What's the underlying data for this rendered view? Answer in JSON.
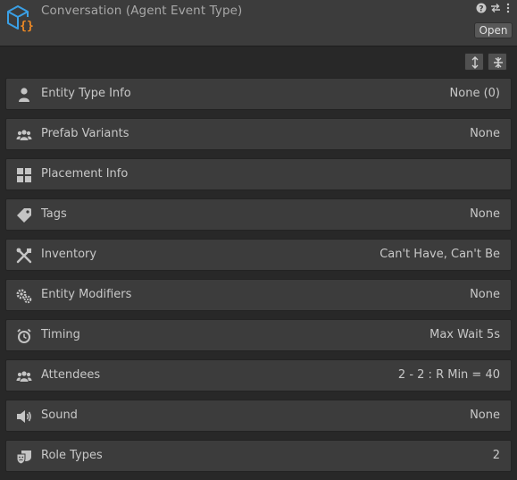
{
  "header": {
    "title": "Conversation (Agent Event Type)",
    "open_label": "Open",
    "help_glyph": "?",
    "settings_glyph": "⇄",
    "more_glyph": "⋮"
  },
  "toolbar": {
    "expand_all_icon": "expand-all-icon",
    "collapse_all_icon": "collapse-all-icon"
  },
  "rows": [
    {
      "label": "Entity Type Info",
      "value": "None (0)",
      "icon": "person-icon"
    },
    {
      "label": "Prefab Variants",
      "value": "None",
      "icon": "group-icon"
    },
    {
      "label": "Placement Info",
      "value": "",
      "icon": "grid-icon"
    },
    {
      "label": "Tags",
      "value": "None",
      "icon": "tag-icon"
    },
    {
      "label": "Inventory",
      "value": "Can't Have, Can't Be",
      "icon": "tools-icon"
    },
    {
      "label": "Entity Modifiers",
      "value": "None",
      "icon": "gears-icon"
    },
    {
      "label": "Timing",
      "value": "Max Wait 5s",
      "icon": "clock-icon"
    },
    {
      "label": "Attendees",
      "value": "2 - 2 : R Min = 40",
      "icon": "group-icon"
    },
    {
      "label": "Sound",
      "value": "None",
      "icon": "speaker-icon"
    },
    {
      "label": "Role Types",
      "value": "2",
      "icon": "masks-icon"
    }
  ],
  "colors": {
    "background": "#282828",
    "row_background": "#3c3c3c",
    "icon_primary": "#3aa0e6",
    "icon_accent": "#f08a24"
  }
}
